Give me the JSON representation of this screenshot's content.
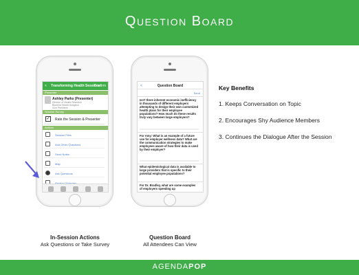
{
  "header": {
    "title": "Question Board"
  },
  "phone1": {
    "nav_back": "<",
    "nav_title": "Transforming Health Sessions",
    "nav_right": "Confirm",
    "section_presenter": "Presenter",
    "presenter_name": "Ashley Parks (Presenter)",
    "presenter_lines": [
      "Director of Health Research",
      "Bluebird Health Analytics",
      "Vice President"
    ],
    "section_rate": "Session Survey",
    "rate_label": "Rate the Session & Presenter",
    "section_actions": "Actions",
    "menu": [
      "Session Files",
      "Add Other Questions",
      "Send Notes",
      "Map",
      "Ask Questions",
      "Related Websites"
    ]
  },
  "phone2": {
    "nav_back": "<",
    "nav_title": "Question Board",
    "send_label": "Send",
    "questions": [
      "Isn't there inherent economic inefficiency in thousands of different employers attempting to design their own customized health plans for their employee populations? How much do these results truly vary between large employers?",
      "For Amy: What is an example of a future use for employer wellness data? What are the communication strategies to make employees aware of how their data is used by their employer?",
      "What epidemiological data is available to large providers that is specific to their potential employee populations?",
      "For Dr. Bradley, what are some examples of employers speeding up"
    ]
  },
  "captions": {
    "left_title": "In-Session Actions",
    "left_sub": "Ask Questions or Take Survey",
    "right_title": "Question Board",
    "right_sub": "All Attendees Can View"
  },
  "benefits": {
    "title": "Key Benefits",
    "items": [
      "1. Keeps Conversation on Topic",
      "2. Encourages Shy Audience Members",
      "3. Continues the Dialogue After the Session"
    ]
  },
  "footer": {
    "logo_a": "AGENDA",
    "logo_b": "POP"
  },
  "colors": {
    "brand_green": "#3fae49",
    "arrow": "#5a5bd6"
  }
}
